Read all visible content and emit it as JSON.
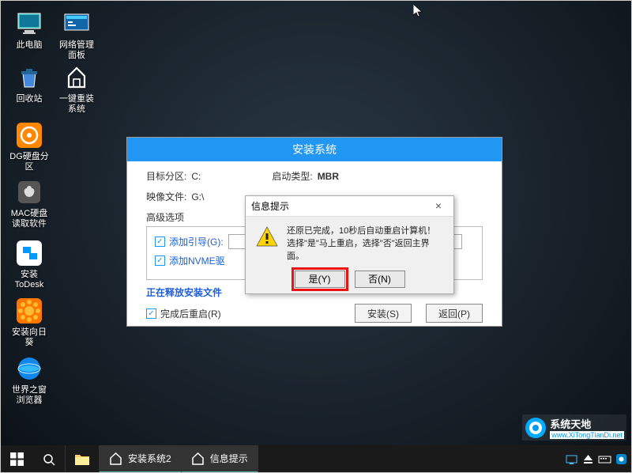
{
  "desktop": {
    "icons": [
      {
        "label": "此电脑"
      },
      {
        "label": "网络管理面板"
      },
      {
        "label": "回收站"
      },
      {
        "label": "一键重装系统"
      },
      {
        "label": "DG硬盘分区"
      },
      {
        "label": "MAC硬盘读取软件"
      },
      {
        "label": "安装ToDesk"
      },
      {
        "label": "安装向日葵"
      },
      {
        "label": "世界之窗浏览器"
      }
    ]
  },
  "install_window": {
    "title": "安装系统",
    "target_label": "目标分区:",
    "target_value": "C:",
    "boot_type_label": "启动类型:",
    "boot_type_value": "MBR",
    "image_label": "映像文件:",
    "image_value": "G:\\",
    "adv_section": "高级选项",
    "opt_boot": "添加引导(G):",
    "opt_nvme": "添加NVME驱",
    "progress_text": "正在释放安装文件",
    "opt_reboot": "完成后重启(R)",
    "install_btn": "安装(S)",
    "back_btn": "返回(P)"
  },
  "dialog": {
    "title": "信息提示",
    "line1": "还原已完成，10秒后自动重启计算机！",
    "line2": "选择\"是\"马上重启，选择\"否\"返回主界面。",
    "yes_btn": "是(Y)",
    "no_btn": "否(N)"
  },
  "taskbar": {
    "app1": "安装系统2",
    "app2": "信息提示"
  },
  "watermark": {
    "text": "系统天地",
    "url": "www.XiTongTianDi.net"
  }
}
